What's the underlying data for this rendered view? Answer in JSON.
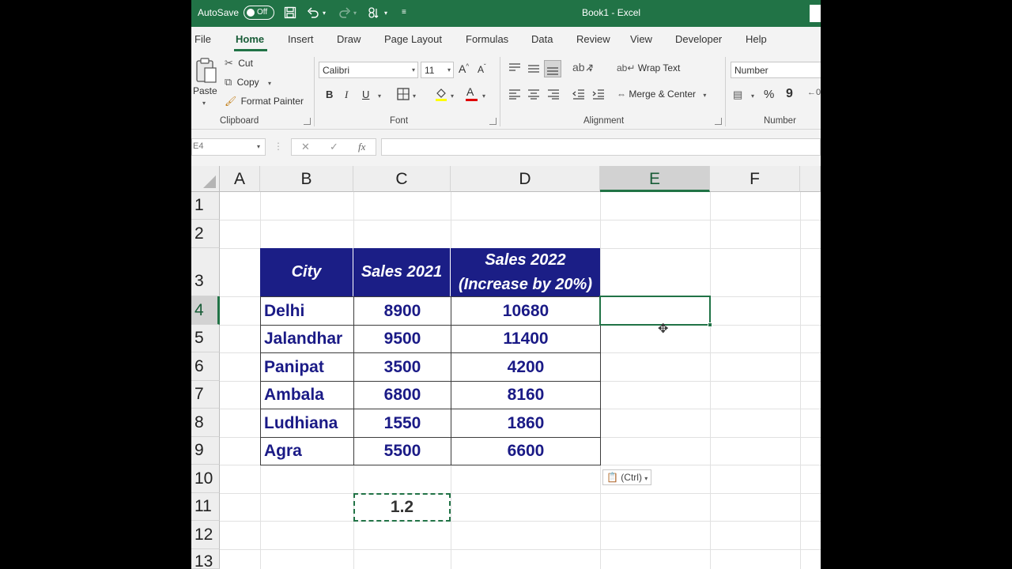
{
  "titlebar": {
    "autosave_label": "AutoSave",
    "autosave_state": "Off",
    "window_title": "Book1  -  Excel"
  },
  "menu": {
    "tabs": [
      "File",
      "Home",
      "Insert",
      "Draw",
      "Page Layout",
      "Formulas",
      "Data",
      "Review",
      "View",
      "Developer",
      "Help"
    ],
    "active": "Home"
  },
  "ribbon": {
    "clipboard": {
      "paste": "Paste",
      "cut": "Cut",
      "copy": "Copy",
      "format_painter": "Format Painter",
      "group": "Clipboard"
    },
    "font": {
      "name": "Calibri",
      "size": "11",
      "group": "Font",
      "bold": "B",
      "italic": "I",
      "underline": "U"
    },
    "alignment": {
      "wrap_text": "Wrap Text",
      "merge_center": "Merge & Center",
      "group": "Alignment"
    },
    "number": {
      "format": "Number",
      "group": "Number"
    }
  },
  "formula_bar": {
    "name_box": "E4",
    "fx": "fx",
    "formula": ""
  },
  "grid": {
    "columns": [
      "A",
      "B",
      "C",
      "D",
      "E",
      "F"
    ],
    "rows": [
      "1",
      "2",
      "3",
      "4",
      "5",
      "6",
      "7",
      "8",
      "9",
      "10",
      "11",
      "12",
      "13"
    ],
    "selected_column": "E",
    "selected_row": "4"
  },
  "table": {
    "headers": [
      "City",
      "Sales 2021",
      "Sales 2022",
      "(Increase by 20%)"
    ],
    "rows": [
      [
        "Delhi",
        "8900",
        "10680"
      ],
      [
        "Jalandhar",
        "9500",
        "11400"
      ],
      [
        "Panipat",
        "3500",
        "4200"
      ],
      [
        "Ambala",
        "6800",
        "8160"
      ],
      [
        "Ludhiana",
        "1550",
        "1860"
      ],
      [
        "Agra",
        "5500",
        "6600"
      ]
    ]
  },
  "copied_cell": "1.2",
  "paste_options": "(Ctrl)",
  "colors": {
    "excel_green": "#217346",
    "header_fill": "#1b1e86",
    "data_text": "#1a1a86"
  }
}
